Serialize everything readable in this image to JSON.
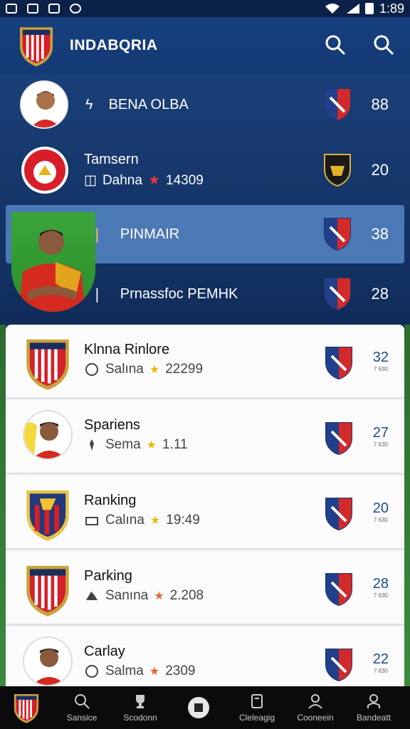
{
  "status_bar": {
    "time": "1:89"
  },
  "header": {
    "title": "INDABQRIA"
  },
  "dark_rows": [
    {
      "name": "BENA OLBA",
      "value": "88"
    },
    {
      "name": "Tamsern",
      "sub_text": "Dahna",
      "sub_value": "14309",
      "value": "20"
    },
    {
      "name": "PINMAIR",
      "value": "38"
    },
    {
      "name": "Prnassfoc PEMHK",
      "value": "28"
    }
  ],
  "cards": [
    {
      "title": "Klnna Rinlore",
      "sub_text": "Salına",
      "sub_value": "22299",
      "rank": "32",
      "rank_sub": "7 630"
    },
    {
      "title": "Spariens",
      "sub_text": "Sema",
      "sub_value": "1.11",
      "rank": "27",
      "rank_sub": "7 630"
    },
    {
      "title": "Ranking",
      "sub_text": "Calına",
      "sub_value": "19:49",
      "rank": "20",
      "rank_sub": "7 630"
    },
    {
      "title": "Parking",
      "sub_text": "Sanına",
      "sub_value": "2.208",
      "rank": "28",
      "rank_sub": "7 630"
    },
    {
      "title": "Carlay",
      "sub_text": "Salma",
      "sub_value": "2309",
      "rank": "22",
      "rank_sub": "7 630"
    }
  ],
  "nav": [
    {
      "label": "Sansice",
      "icon": "search-icon"
    },
    {
      "label": "Scodonn",
      "icon": "trophy-icon"
    },
    {
      "label": "",
      "icon": "ball-icon"
    },
    {
      "label": "Cleleagig",
      "icon": "card-icon"
    },
    {
      "label": "Cooneein",
      "icon": "profile-icon"
    },
    {
      "label": "Bandeatt",
      "icon": "user-icon"
    }
  ],
  "colors": {
    "primary": "#13356b",
    "highlight": "#4b79b5",
    "rank": "#1f4f8a",
    "star": "#f2b705"
  }
}
